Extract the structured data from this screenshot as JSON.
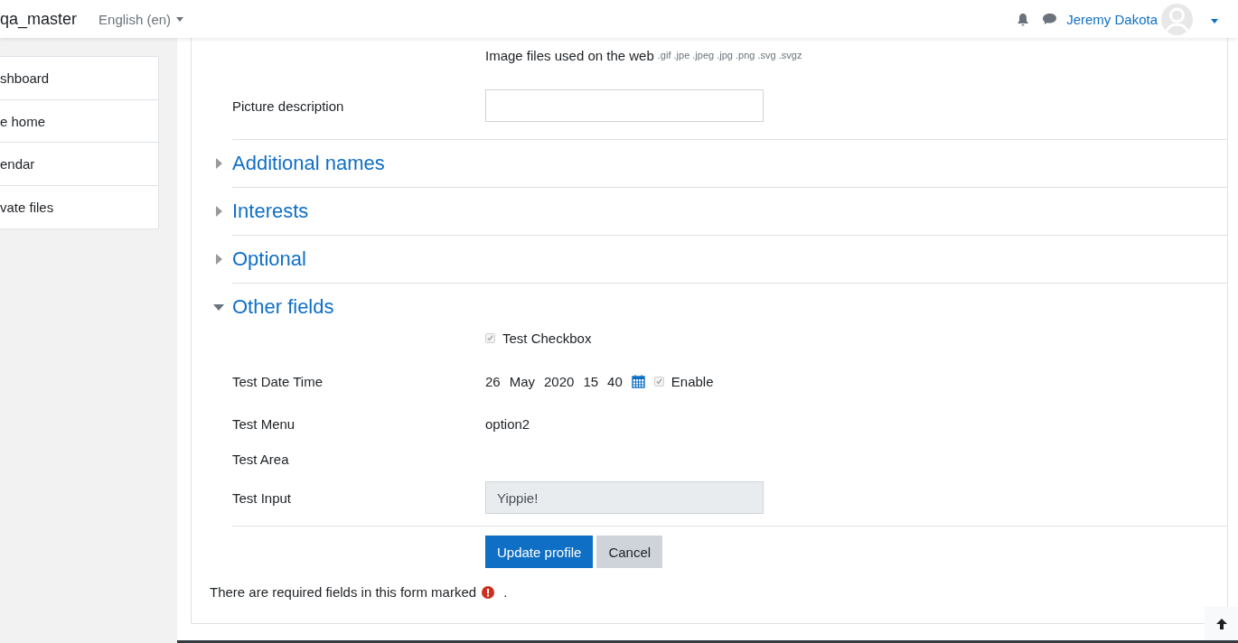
{
  "navbar": {
    "site_name": "qa_master",
    "language": "English (en)",
    "user_name": "Jeremy Dakota"
  },
  "sidebar": {
    "items": [
      {
        "label": "shboard"
      },
      {
        "label": "e home"
      },
      {
        "label": "endar"
      },
      {
        "label": "vate files"
      }
    ]
  },
  "form": {
    "file_types": {
      "label": "Image files used on the web",
      "extensions": ".gif .jpe .jpeg .jpg .png .svg .svgz"
    },
    "picture_description": {
      "label": "Picture description"
    },
    "sections": [
      {
        "title": "Additional names",
        "expanded": false
      },
      {
        "title": "Interests",
        "expanded": false
      },
      {
        "title": "Optional",
        "expanded": false
      },
      {
        "title": "Other fields",
        "expanded": true
      }
    ],
    "other_fields": [
      {
        "kind": "checkbox",
        "text": "Test Checkbox",
        "checked": true,
        "disabled": true
      },
      {
        "kind": "datetime",
        "label": "Test Date Time",
        "parts": [
          "26",
          "May",
          "2020",
          "15",
          "40"
        ],
        "enable_label": "Enable",
        "checked": true,
        "disabled": true
      },
      {
        "kind": "static",
        "label": "Test Menu",
        "value": "option2"
      },
      {
        "kind": "static",
        "label": "Test Area"
      },
      {
        "kind": "input",
        "label": "Test Input",
        "value": "Yippie!",
        "disabled": true
      }
    ],
    "buttons": [
      {
        "label": "Update profile",
        "kind": "primary"
      },
      {
        "label": "Cancel",
        "kind": "secondary"
      }
    ],
    "required_note": {
      "before": "There are required fields in this form marked",
      "after": "."
    }
  }
}
